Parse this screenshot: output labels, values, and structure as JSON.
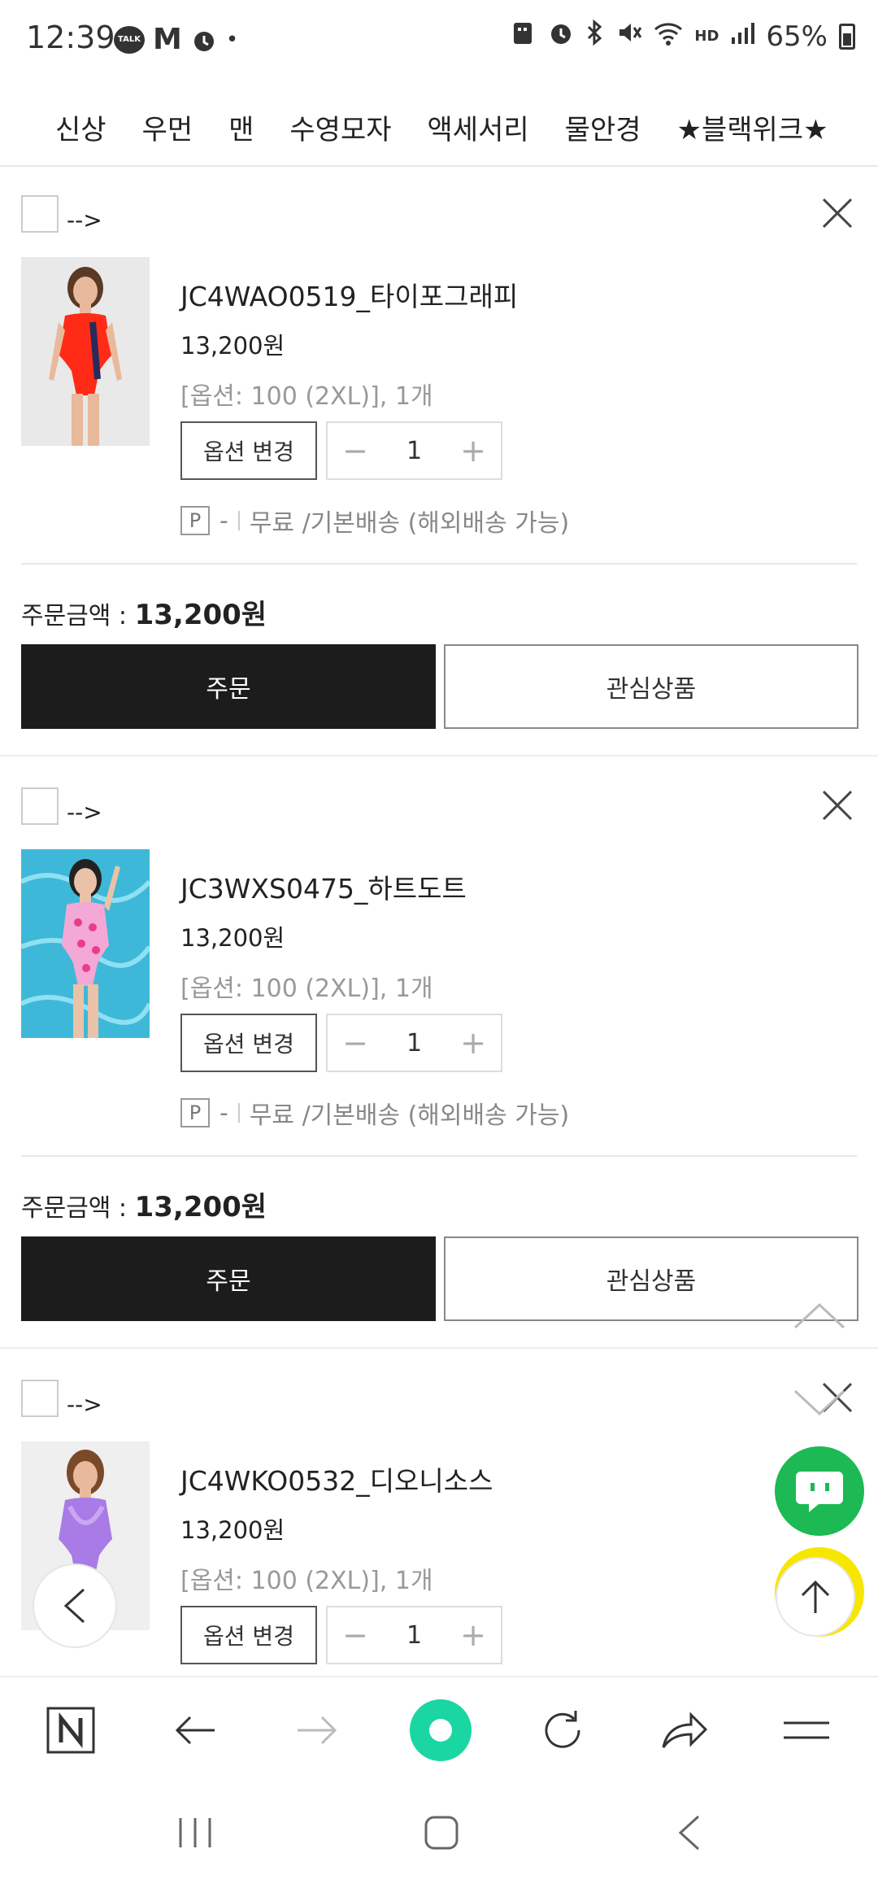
{
  "status": {
    "time": "12:39",
    "talk_label": "TALK",
    "mail_label": "M",
    "dot": "•",
    "battery": "65%",
    "hd_label": "HD"
  },
  "nav": {
    "categories": [
      "신상",
      "우먼",
      "맨",
      "수영모자",
      "액세서리",
      "물안경",
      "★블랙위크★"
    ]
  },
  "cart": {
    "checkbox_label": "-->",
    "option_change_label": "옵션 변경",
    "minus": "−",
    "plus": "+",
    "p_badge": "P",
    "dash": "-",
    "shipping_text": "무료 /기본배송 (해외배송 가능)",
    "total_label": "주문금액 : ",
    "order_label": "주문",
    "wish_label": "관심상품",
    "items": [
      {
        "name": "JC4WAO0519_타이포그래피",
        "price": "13,200원",
        "option": "[옵션: 100 (2XL)], 1개",
        "qty": "1",
        "total": "13,200원"
      },
      {
        "name": "JC3WXS0475_하트도트",
        "price": "13,200원",
        "option": "[옵션: 100 (2XL)], 1개",
        "qty": "1",
        "total": "13,200원"
      },
      {
        "name": "JC4WKO0532_디오니소스",
        "price": "13,200원",
        "option": "[옵션: 100 (2XL)], 1개",
        "qty": "1"
      }
    ]
  },
  "colors": {
    "order_button": "#1c1c1c",
    "chat_fab": "#1db954",
    "kakao_fab": "#f7e600",
    "browser_center": "#19d6a3"
  }
}
